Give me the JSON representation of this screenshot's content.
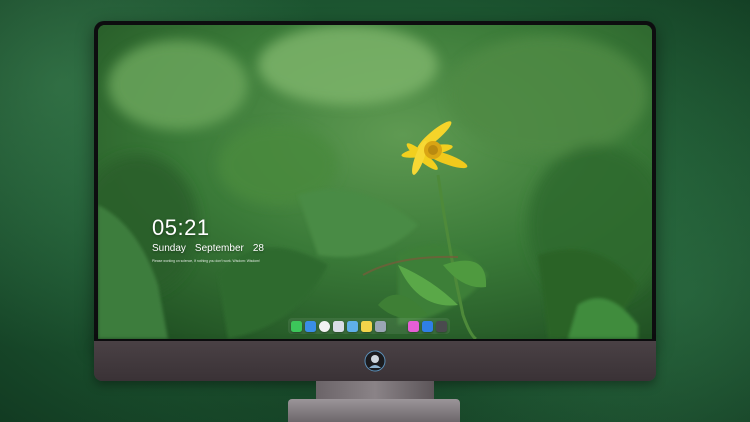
{
  "lock_screen": {
    "time": "05:21",
    "weekday": "Sunday",
    "month": "September",
    "day": "28",
    "quote": "Please working on science, If nothing you don't work. Wisdom: Wisdom!"
  },
  "dock": {
    "apps": [
      {
        "icon": "messages-icon",
        "color": "#3cc65a"
      },
      {
        "icon": "finder-icon",
        "color": "#3a8ee6"
      },
      {
        "icon": "clock-icon",
        "color": "#f2f2f2"
      },
      {
        "icon": "preview-icon",
        "color": "#d9dde6"
      },
      {
        "icon": "claquette-icon",
        "color": "#5fb0e8"
      },
      {
        "icon": "notes-icon",
        "color": "#f3d54a"
      },
      {
        "icon": "photos-icon",
        "color": "#9aa6b5"
      },
      {
        "icon": "itunes-icon",
        "color": "#e55fd6"
      },
      {
        "icon": "app-store-icon",
        "color": "#2f7fe6"
      },
      {
        "icon": "screenshot-icon",
        "color": "#4a4a4e"
      }
    ]
  },
  "colors": {
    "background": "#1f5c34",
    "bezel": "#0d0d0f",
    "chin": "#423a3e",
    "flower": "#f2cf1e"
  }
}
